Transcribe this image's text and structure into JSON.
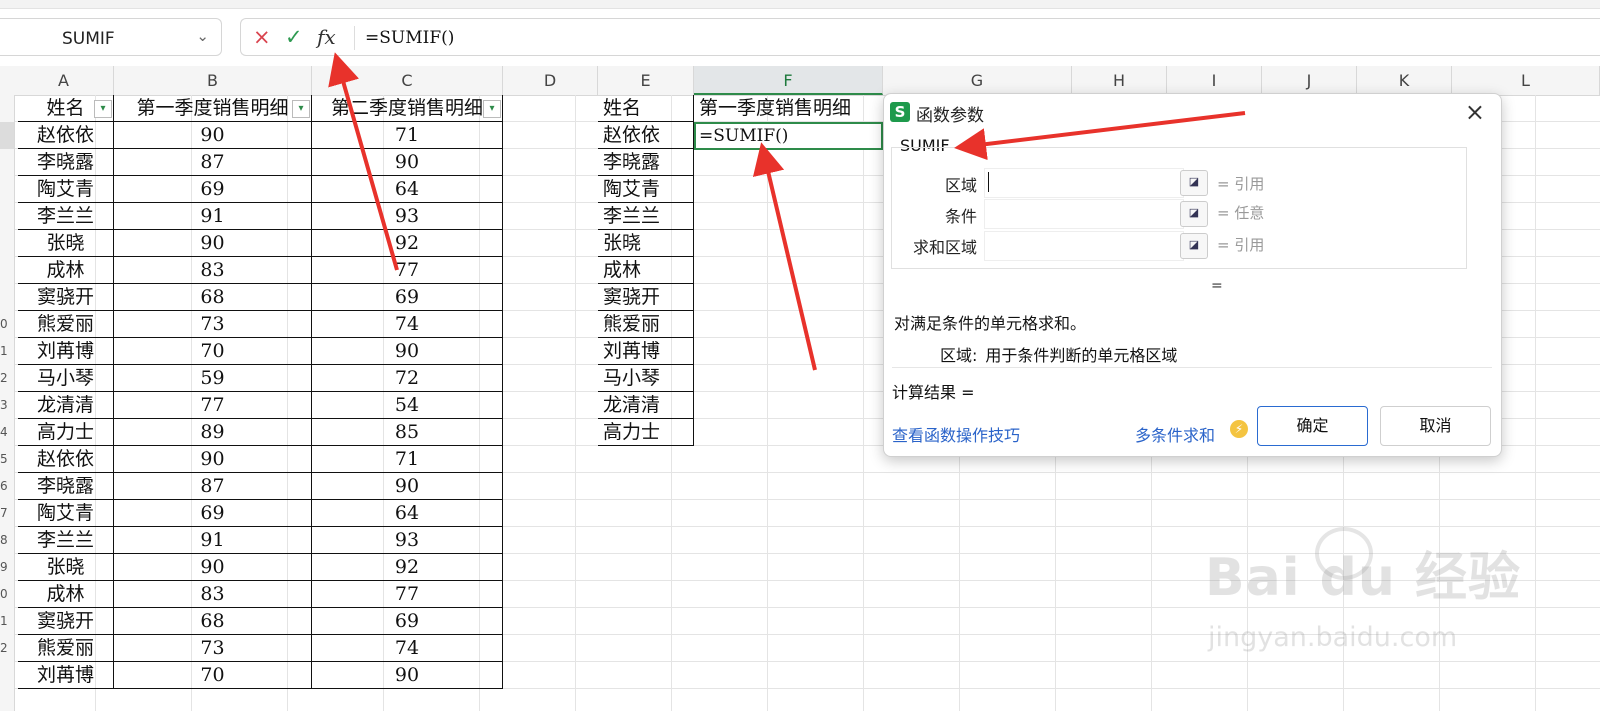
{
  "formula_bar": {
    "name_box": "SUMIF",
    "cancel_glyph": "×",
    "accept_glyph": "✓",
    "fx_glyph": "fx",
    "formula": "=SUMIF()"
  },
  "columns": [
    "A",
    "B",
    "C",
    "D",
    "E",
    "F",
    "G",
    "H",
    "I",
    "J",
    "K",
    "L"
  ],
  "row_numbers": [
    "",
    "",
    "",
    "",
    "",
    "",
    "",
    "",
    "0",
    "1",
    "2",
    "3",
    "4",
    "5",
    "6",
    "7",
    "8",
    "9",
    "0",
    "1",
    "2"
  ],
  "headers": {
    "a": "姓名",
    "b": "第一季度销售明细",
    "c": "第二季度销售明细",
    "e": "姓名",
    "f": "第一季度销售明细"
  },
  "table_rows": [
    {
      "name": "赵依依",
      "q1": "90",
      "q2": "71"
    },
    {
      "name": "李晓露",
      "q1": "87",
      "q2": "90"
    },
    {
      "name": "陶艾青",
      "q1": "69",
      "q2": "64"
    },
    {
      "name": "李兰兰",
      "q1": "91",
      "q2": "93"
    },
    {
      "name": "张晓",
      "q1": "90",
      "q2": "92"
    },
    {
      "name": "成林",
      "q1": "83",
      "q2": "77"
    },
    {
      "name": "窦骁开",
      "q1": "68",
      "q2": "69"
    },
    {
      "name": "熊爱丽",
      "q1": "73",
      "q2": "74"
    },
    {
      "name": "刘苒博",
      "q1": "70",
      "q2": "90"
    },
    {
      "name": "马小琴",
      "q1": "59",
      "q2": "72"
    },
    {
      "name": "龙清清",
      "q1": "77",
      "q2": "54"
    },
    {
      "name": "高力士",
      "q1": "89",
      "q2": "85"
    },
    {
      "name": "赵依依",
      "q1": "90",
      "q2": "71"
    },
    {
      "name": "李晓露",
      "q1": "87",
      "q2": "90"
    },
    {
      "name": "陶艾青",
      "q1": "69",
      "q2": "64"
    },
    {
      "name": "李兰兰",
      "q1": "91",
      "q2": "93"
    },
    {
      "name": "张晓",
      "q1": "90",
      "q2": "92"
    },
    {
      "name": "成林",
      "q1": "83",
      "q2": "77"
    },
    {
      "name": "窦骁开",
      "q1": "68",
      "q2": "69"
    },
    {
      "name": "熊爱丽",
      "q1": "73",
      "q2": "74"
    },
    {
      "name": "刘苒博",
      "q1": "70",
      "q2": "90"
    }
  ],
  "lookup_names": [
    "赵依依",
    "李晓露",
    "陶艾青",
    "李兰兰",
    "张晓",
    "成林",
    "窦骁开",
    "熊爱丽",
    "刘苒博",
    "马小琴",
    "龙清清",
    "高力士"
  ],
  "editing_cell": "=SUMIF()",
  "dialog": {
    "logo": "S",
    "title": "函数参数",
    "close": "×",
    "function_name": "SUMIF",
    "params": [
      {
        "label": "区域",
        "type": "= 引用"
      },
      {
        "label": "条件",
        "type": "= 任意"
      },
      {
        "label": "求和区域",
        "type": "= 引用"
      }
    ],
    "result_eq": "=",
    "description": "对满足条件的单元格求和。",
    "param_desc_key": "区域:",
    "param_desc_text": "用于条件判断的单元格区域",
    "calc_result": "计算结果 =",
    "tips_link": "查看函数操作技巧",
    "multi_link": "多条件求和",
    "ok": "确定",
    "cancel": "取消"
  },
  "watermark": {
    "brand": "Bai du 经验",
    "url": "jingyan.baidu.com"
  }
}
